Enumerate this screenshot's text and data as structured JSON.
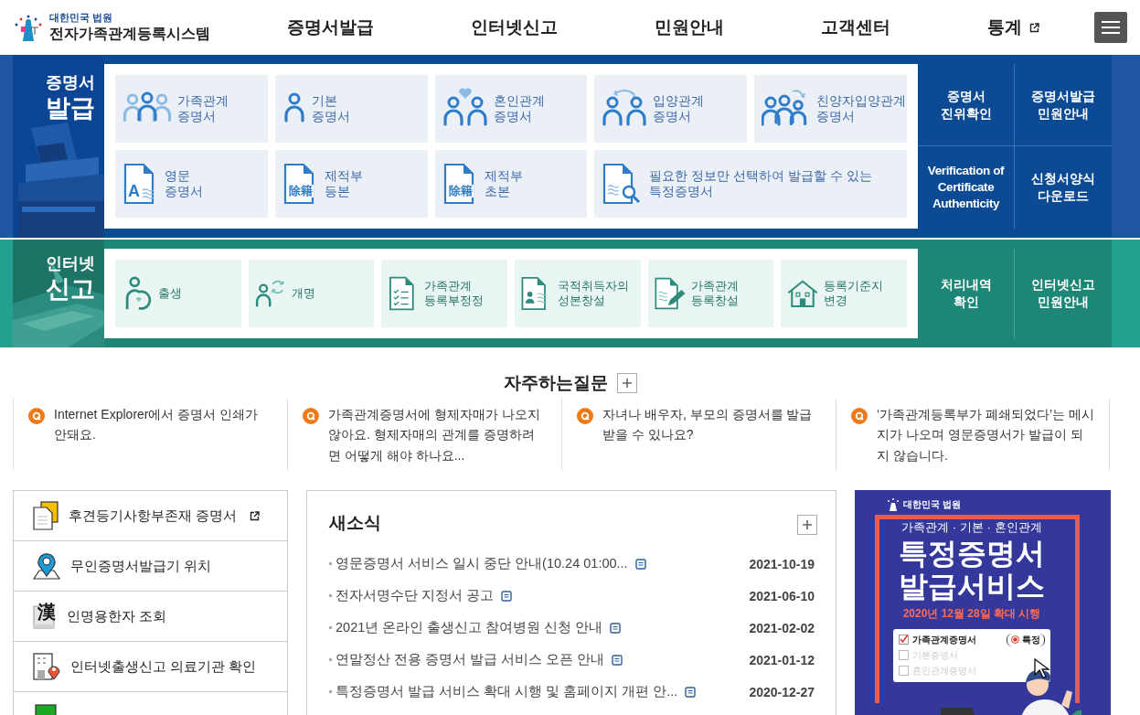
{
  "header": {
    "logo": {
      "org": "대한민국 법원",
      "name": "전자가족관계등록시스템"
    },
    "nav": [
      {
        "label": "증명서발급",
        "external": false
      },
      {
        "label": "인터넷신고",
        "external": false
      },
      {
        "label": "민원안내",
        "external": false
      },
      {
        "label": "고객센터",
        "external": false
      },
      {
        "label": "통계",
        "external": true
      }
    ]
  },
  "certificates": {
    "title": "증명서",
    "subtitle": "발급",
    "tiles": [
      {
        "label": "가족관계\n증명서",
        "kind": "family",
        "wide": false
      },
      {
        "label": "기본\n증명서",
        "kind": "person",
        "wide": false
      },
      {
        "label": "혼인관계\n증명서",
        "kind": "couple-heart",
        "wide": false
      },
      {
        "label": "입양관계\n증명서",
        "kind": "couple-arrows",
        "wide": false
      },
      {
        "label": "친양자입양관계\n증명서",
        "kind": "family-arrows",
        "wide": false
      },
      {
        "label": "영문\n증명서",
        "kind": "doc-letter",
        "icon_text": "A",
        "wide": false
      },
      {
        "label": "제적부\n등본",
        "kind": "doc-hanja",
        "icon_text": "除籍",
        "wide": false
      },
      {
        "label": "제적부\n초본",
        "kind": "doc-hanja",
        "icon_text": "除籍",
        "wide": false
      },
      {
        "label": "필요한 정보만 선택하여 발급할 수 있는\n특정증명서",
        "kind": "doc-search",
        "wide": true
      }
    ],
    "links": [
      "증명서\n진위확인",
      "증명서발급\n민원안내",
      "Verification of\nCertificate\nAuthenticity",
      "신청서양식\n다운로드"
    ]
  },
  "reports": {
    "title": "인터넷",
    "subtitle": "신고",
    "tiles": [
      {
        "label": "출생",
        "kind": "birth"
      },
      {
        "label": "개명",
        "kind": "rename"
      },
      {
        "label": "가족관계\n등록부정정",
        "kind": "checklist"
      },
      {
        "label": "국적취득자의\n성본창설",
        "kind": "idcard"
      },
      {
        "label": "가족관계\n등록창설",
        "kind": "docpen"
      },
      {
        "label": "등록기준지\n변경",
        "kind": "house"
      }
    ],
    "links": [
      "처리내역\n확인",
      "인터넷신고\n민원안내"
    ]
  },
  "faq": {
    "title": "자주하는질문",
    "items": [
      {
        "text": "Internet Explorer에서 증명서 인쇄가 안돼요."
      },
      {
        "text": "가족관계증명서에 형제자매가 나오지 않아요. 형제자매의 관계를 증명하려면 어떻게 해야 하나요..."
      },
      {
        "text": "자녀나 배우자, 부모의 증명서를 발급 받을 수 있나요?"
      },
      {
        "text": "‘가족관계등록부가 폐쇄되었다’는 메시지가 나오며 영문증명서가 발급이 되지 않습니다."
      }
    ]
  },
  "quick_links": [
    {
      "label": "후견등기사항부존재 증명서",
      "kind": "documents",
      "external": true
    },
    {
      "label": "무인증명서발급기 위치",
      "kind": "map-pin",
      "external": false
    },
    {
      "label": "인명용한자 조회",
      "kind": "hanja-book",
      "icon_text": "漢",
      "external": false
    },
    {
      "label": "인터넷출생신고 의료기관 확인",
      "kind": "building-pin",
      "external": false
    },
    {
      "kind": "green-book"
    }
  ],
  "news": {
    "title": "새소식",
    "items": [
      {
        "title": "영문증명서 서비스 일시 중단 안내(10.24 01:00...",
        "date": "2021-10-19",
        "attachment": true
      },
      {
        "title": "전자서명수단 지정서 공고",
        "date": "2021-06-10",
        "attachment": true
      },
      {
        "title": "2021년 온라인 출생신고 참여병원 신청 안내",
        "date": "2021-02-02",
        "attachment": true
      },
      {
        "title": "연말정산 전용 증명서 발급 서비스 오픈 안내",
        "date": "2021-01-12",
        "attachment": true
      },
      {
        "title": "특정증명서 발급 서비스 확대 시행 및 홈페이지 개편 안...",
        "date": "2020-12-27",
        "attachment": true
      }
    ]
  },
  "banner": {
    "org": "대한민국 법원",
    "subtitle": "가족관계 · 기본 · 혼인관계",
    "headline": "특정증명서\n발급서비스",
    "date": "2020년 12월 28일 확대 시행",
    "options": [
      {
        "label": "가족관계증명서",
        "checked": true,
        "tag": "특정"
      },
      {
        "label": "기본증명서",
        "checked": false
      },
      {
        "label": "혼인관계증명서",
        "checked": false
      }
    ]
  }
}
